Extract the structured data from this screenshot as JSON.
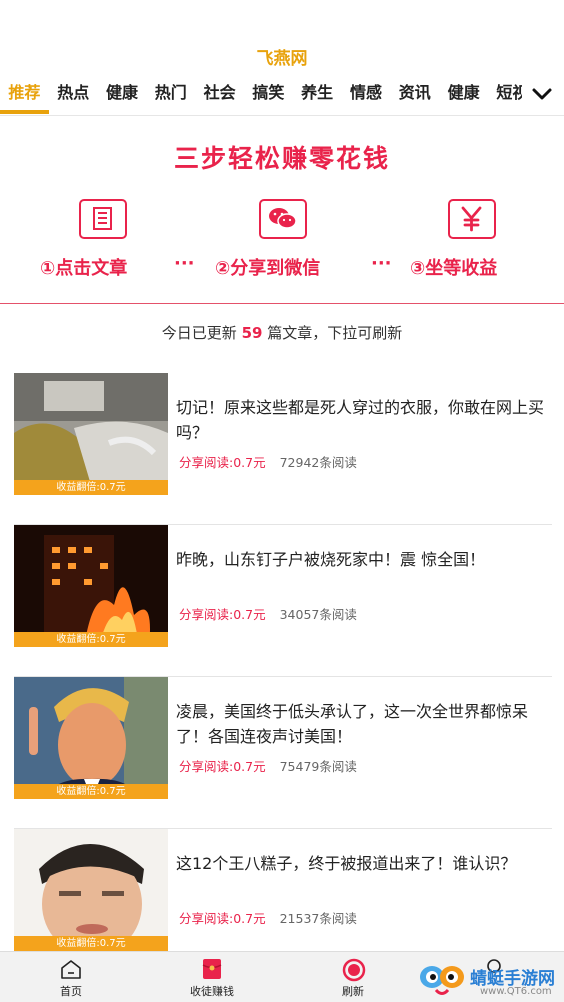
{
  "app": {
    "title": "飞燕网"
  },
  "tabs": [
    "推荐",
    "热点",
    "健康",
    "热门",
    "社会",
    "搞笑",
    "养生",
    "情感",
    "资讯",
    "健康",
    "短视"
  ],
  "active_tab": 0,
  "banner": {
    "title": "三步轻松赚零花钱",
    "steps": [
      "①点击文章",
      "②分享到微信",
      "③坐等收益"
    ],
    "dots": "···",
    "accent": "#e9234b"
  },
  "update": {
    "prefix": "今日已更新 ",
    "count": "59",
    "suffix": " 篇文章，下拉可刷新"
  },
  "articles": [
    {
      "title": "切记！原来这些都是死人穿过的衣服，你敢在网上买吗？",
      "share": "分享阅读:0.7元",
      "reads": "72942条阅读",
      "badge": "收益翻倍:0.7元"
    },
    {
      "title": "昨晚，山东钉子户被烧死家中！震 惊全国！",
      "share": "分享阅读:0.7元",
      "reads": "34057条阅读",
      "badge": "收益翻倍:0.7元"
    },
    {
      "title": "凌晨，美国终于低头承认了，这一次全世界都惊呆了！各国连夜声讨美国！",
      "share": "分享阅读:0.7元",
      "reads": "75479条阅读",
      "badge": "收益翻倍:0.7元"
    },
    {
      "title": "这12个王八糕子，终于被报道出来了！谁认识？",
      "share": "分享阅读:0.7元",
      "reads": "21537条阅读",
      "badge": "收益翻倍:0.7元"
    }
  ],
  "bottom_nav": [
    {
      "label": "首页",
      "icon": "home-icon"
    },
    {
      "label": "收徒赚钱",
      "icon": "red-envelope-icon"
    },
    {
      "label": "刷新",
      "icon": "refresh-icon"
    },
    {
      "label": "",
      "icon": "profile-icon"
    }
  ],
  "watermark": {
    "text": "蜻蜓手游网",
    "url": "www.QT6.com"
  },
  "colors": {
    "brand": "#e8a20c",
    "accent": "#e9234b",
    "badge": "#f4a31c"
  }
}
